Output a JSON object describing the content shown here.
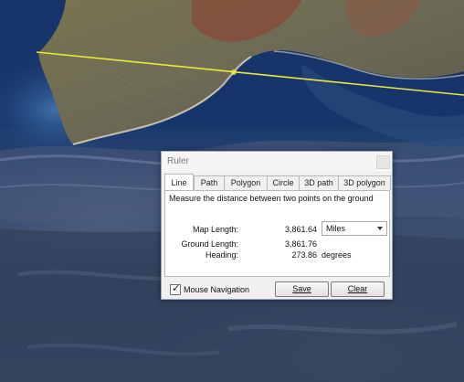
{
  "dialog": {
    "title": "Ruler",
    "tabs": [
      {
        "label": "Line",
        "active": true
      },
      {
        "label": "Path",
        "active": false
      },
      {
        "label": "Polygon",
        "active": false
      },
      {
        "label": "Circle",
        "active": false
      },
      {
        "label": "3D path",
        "active": false
      },
      {
        "label": "3D polygon",
        "active": false
      }
    ],
    "description": "Measure the distance between two points on the ground",
    "map_length": {
      "label": "Map Length:",
      "value": "3,861.64"
    },
    "unit_select": {
      "value": "Miles"
    },
    "ground_length": {
      "label": "Ground Length:",
      "value": "3,861.76"
    },
    "heading": {
      "label": "Heading:",
      "value": "273.86",
      "unit": "degrees"
    },
    "mouse_navigation": {
      "label": "Mouse Navigation",
      "checked": true,
      "check_glyph": "✓"
    },
    "save_label": "Save",
    "clear_label": "Clear"
  },
  "map": {
    "measure_line_color": "#e8ea3c",
    "ocean_color": "#1c3f79",
    "land_color": "#6a6748"
  }
}
